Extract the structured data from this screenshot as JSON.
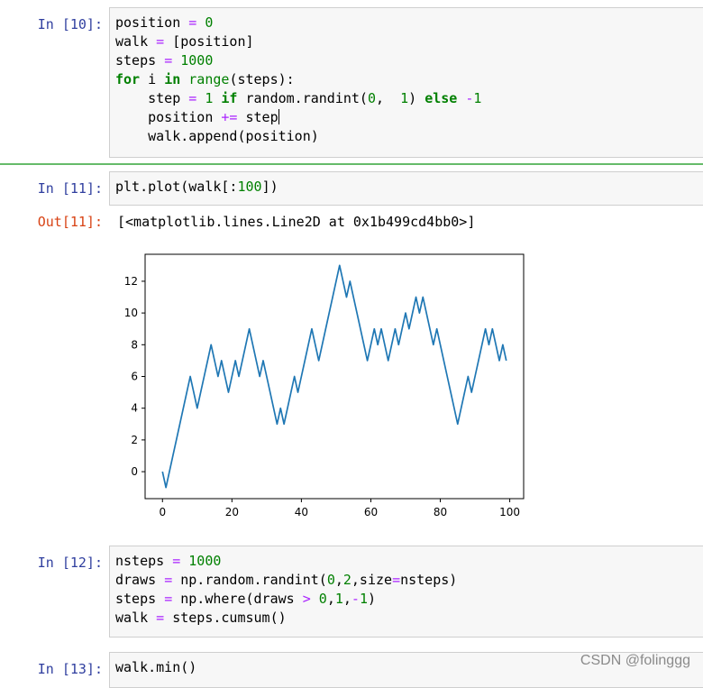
{
  "cells": {
    "c10": {
      "prompt": "In  [10]:",
      "lines": [
        [
          [
            "position ",
            ""
          ],
          [
            "=",
            "op"
          ],
          [
            " ",
            ""
          ],
          [
            "0",
            "num"
          ]
        ],
        [
          [
            "walk ",
            ""
          ],
          [
            "=",
            "op"
          ],
          [
            " [position]",
            ""
          ]
        ],
        [
          [
            "steps ",
            ""
          ],
          [
            "=",
            "op"
          ],
          [
            " ",
            ""
          ],
          [
            "1000",
            "num"
          ]
        ],
        [
          [
            "for",
            "kw"
          ],
          [
            " i ",
            ""
          ],
          [
            "in",
            "kw"
          ],
          [
            " ",
            ""
          ],
          [
            "range",
            "bi"
          ],
          [
            "(steps):",
            ""
          ]
        ],
        [
          [
            "    step ",
            ""
          ],
          [
            "=",
            "op"
          ],
          [
            " ",
            ""
          ],
          [
            "1",
            "num"
          ],
          [
            " ",
            ""
          ],
          [
            "if",
            "kw"
          ],
          [
            " random.randint(",
            ""
          ],
          [
            "0",
            "num"
          ],
          [
            ",  ",
            ""
          ],
          [
            "1",
            "num"
          ],
          [
            ") ",
            ""
          ],
          [
            "else",
            "kw"
          ],
          [
            " ",
            ""
          ],
          [
            "-",
            "op"
          ],
          [
            "1",
            "num"
          ]
        ],
        [
          [
            "    position ",
            ""
          ],
          [
            "+=",
            "op"
          ],
          [
            " step",
            ""
          ]
        ],
        [
          [
            "    walk.append(position)",
            ""
          ]
        ]
      ]
    },
    "c11": {
      "prompt": "In  [11]:",
      "lines": [
        [
          [
            "plt.plot(walk[:",
            ""
          ],
          [
            "100",
            "num"
          ],
          [
            "])",
            ""
          ]
        ]
      ],
      "out_prompt": "Out[11]:",
      "out_text": "[<matplotlib.lines.Line2D at 0x1b499cd4bb0>]"
    },
    "c12": {
      "prompt": "In  [12]:",
      "lines": [
        [
          [
            "nsteps ",
            ""
          ],
          [
            "=",
            "op"
          ],
          [
            " ",
            ""
          ],
          [
            "1000",
            "num"
          ]
        ],
        [
          [
            "draws ",
            ""
          ],
          [
            "=",
            "op"
          ],
          [
            " np.random.randint(",
            ""
          ],
          [
            "0",
            "num"
          ],
          [
            ",",
            ""
          ],
          [
            "2",
            "num"
          ],
          [
            ",size",
            ""
          ],
          [
            "=",
            "op"
          ],
          [
            "nsteps)",
            ""
          ]
        ],
        [
          [
            "steps ",
            ""
          ],
          [
            "=",
            "op"
          ],
          [
            " np.where(draws ",
            ""
          ],
          [
            ">",
            "op"
          ],
          [
            " ",
            ""
          ],
          [
            "0",
            "num"
          ],
          [
            ",",
            ""
          ],
          [
            "1",
            "num"
          ],
          [
            ",",
            ""
          ],
          [
            "-",
            "op"
          ],
          [
            "1",
            "num"
          ],
          [
            ")",
            ""
          ]
        ],
        [
          [
            "walk ",
            ""
          ],
          [
            "=",
            "op"
          ],
          [
            " steps.cumsum()",
            ""
          ]
        ]
      ]
    },
    "c13": {
      "prompt": "In  [13]:",
      "lines": [
        [
          [
            "walk.min()",
            ""
          ]
        ]
      ]
    }
  },
  "watermark": "CSDN @folinggg",
  "chart_data": {
    "type": "line",
    "x": [
      0,
      1,
      2,
      3,
      4,
      5,
      6,
      7,
      8,
      9,
      10,
      11,
      12,
      13,
      14,
      15,
      16,
      17,
      18,
      19,
      20,
      21,
      22,
      23,
      24,
      25,
      26,
      27,
      28,
      29,
      30,
      31,
      32,
      33,
      34,
      35,
      36,
      37,
      38,
      39,
      40,
      41,
      42,
      43,
      44,
      45,
      46,
      47,
      48,
      49,
      50,
      51,
      52,
      53,
      54,
      55,
      56,
      57,
      58,
      59,
      60,
      61,
      62,
      63,
      64,
      65,
      66,
      67,
      68,
      69,
      70,
      71,
      72,
      73,
      74,
      75,
      76,
      77,
      78,
      79,
      80,
      81,
      82,
      83,
      84,
      85,
      86,
      87,
      88,
      89,
      90,
      91,
      92,
      93,
      94,
      95,
      96,
      97,
      98,
      99
    ],
    "series": [
      {
        "values": [
          0,
          -1,
          0,
          1,
          2,
          3,
          4,
          5,
          6,
          5,
          4,
          5,
          6,
          7,
          8,
          7,
          6,
          7,
          6,
          5,
          6,
          7,
          6,
          7,
          8,
          9,
          8,
          7,
          6,
          7,
          6,
          5,
          4,
          3,
          4,
          3,
          4,
          5,
          6,
          5,
          6,
          7,
          8,
          9,
          8,
          7,
          8,
          9,
          10,
          11,
          12,
          13,
          12,
          11,
          12,
          11,
          10,
          9,
          8,
          7,
          8,
          9,
          8,
          9,
          8,
          7,
          8,
          9,
          8,
          9,
          10,
          9,
          10,
          11,
          10,
          11,
          10,
          9,
          8,
          9,
          8,
          7,
          6,
          5,
          4,
          3,
          4,
          5,
          6,
          5,
          6,
          7,
          8,
          9,
          8,
          9,
          8,
          7,
          8,
          7
        ],
        "color": "#1f77b4"
      }
    ],
    "xticks": [
      0,
      20,
      40,
      60,
      80,
      100
    ],
    "yticks": [
      0,
      2,
      4,
      6,
      8,
      10,
      12
    ],
    "xlim": [
      -5,
      104
    ],
    "ylim": [
      -1.7,
      13.7
    ]
  }
}
